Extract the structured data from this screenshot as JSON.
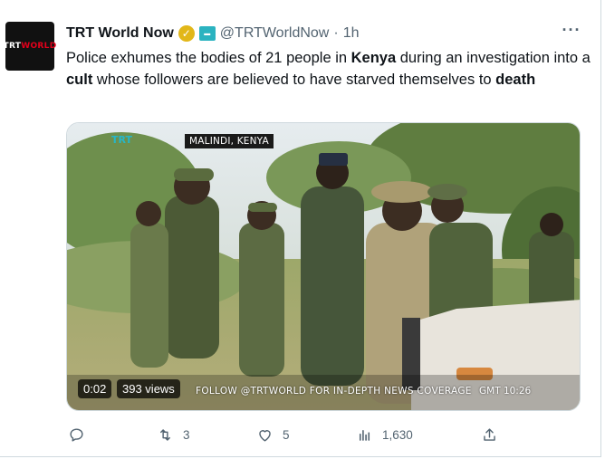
{
  "account": {
    "display_name": "TRT World Now",
    "handle": "@TRTWorldNow",
    "separator": "·",
    "time": "1h",
    "avatar_text_main": "TRT",
    "avatar_text_accent": "WORLD",
    "verified_icon": "gold-check-badge",
    "affiliate_badge": "trt-world-badge"
  },
  "more_label": "···",
  "tweet": {
    "part1": "Police exhumes the bodies of 21 people in ",
    "bold1": "Kenya",
    "part2": " during an investigation into a ",
    "bold2": "cult",
    "part3": " whose followers are believed to have starved themselves to ",
    "bold3": "death"
  },
  "video": {
    "brand": "TRT",
    "location": "MALINDI, KENYA",
    "timestamp": "0:02",
    "views": "393 views",
    "ticker": "FOLLOW @TRTWORLD FOR IN-DEPTH NEWS COVERAGE",
    "gmt": "GMT 10:26"
  },
  "actions": {
    "reply_icon": "reply-icon",
    "retweet_count": "3",
    "like_count": "5",
    "view_count": "1,630",
    "share_icon": "share-icon"
  },
  "colors": {
    "verified": "#e2b719",
    "affiliate": "#2bb3c0",
    "muted": "#536471"
  }
}
